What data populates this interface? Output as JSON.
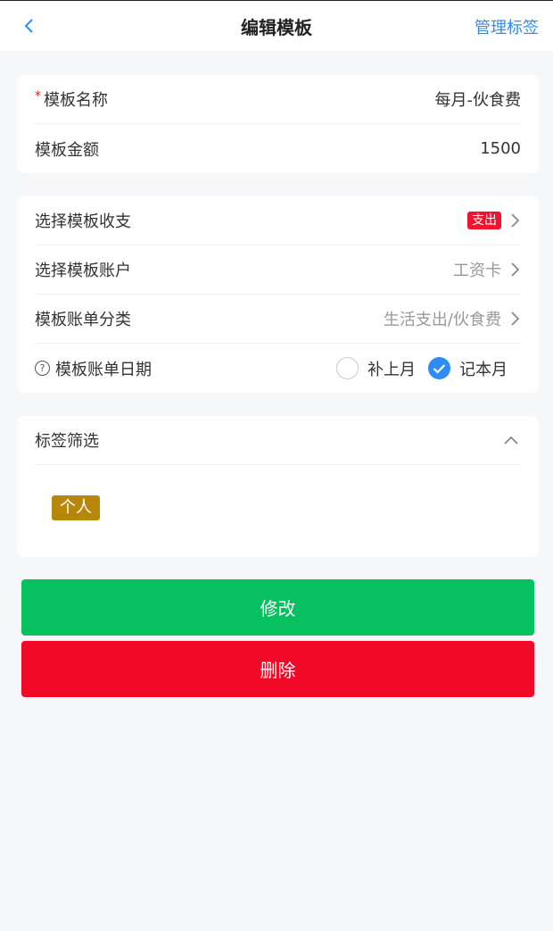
{
  "navbar": {
    "title": "编辑模板",
    "right_label": "管理标签"
  },
  "basic": {
    "name_label": "模板名称",
    "name_value": "每月-伙食费",
    "amount_label": "模板金额",
    "amount_value": "1500"
  },
  "options": {
    "type_label": "选择模板收支",
    "type_value": "支出",
    "account_label": "选择模板账户",
    "account_value": "工资卡",
    "category_label": "模板账单分类",
    "category_value": "生活支出/伙食费",
    "date_label": "模板账单日期",
    "date_options": [
      {
        "label": "补上月",
        "checked": false
      },
      {
        "label": "记本月",
        "checked": true
      }
    ]
  },
  "tags": {
    "header": "标签筛选",
    "items": [
      "个人"
    ]
  },
  "actions": {
    "save_label": "修改",
    "delete_label": "删除"
  },
  "colors": {
    "accent": "#2f8cf0",
    "save": "#07c160",
    "delete": "#f00a28",
    "badge": "#f0142f",
    "tag": "#b8860b"
  }
}
